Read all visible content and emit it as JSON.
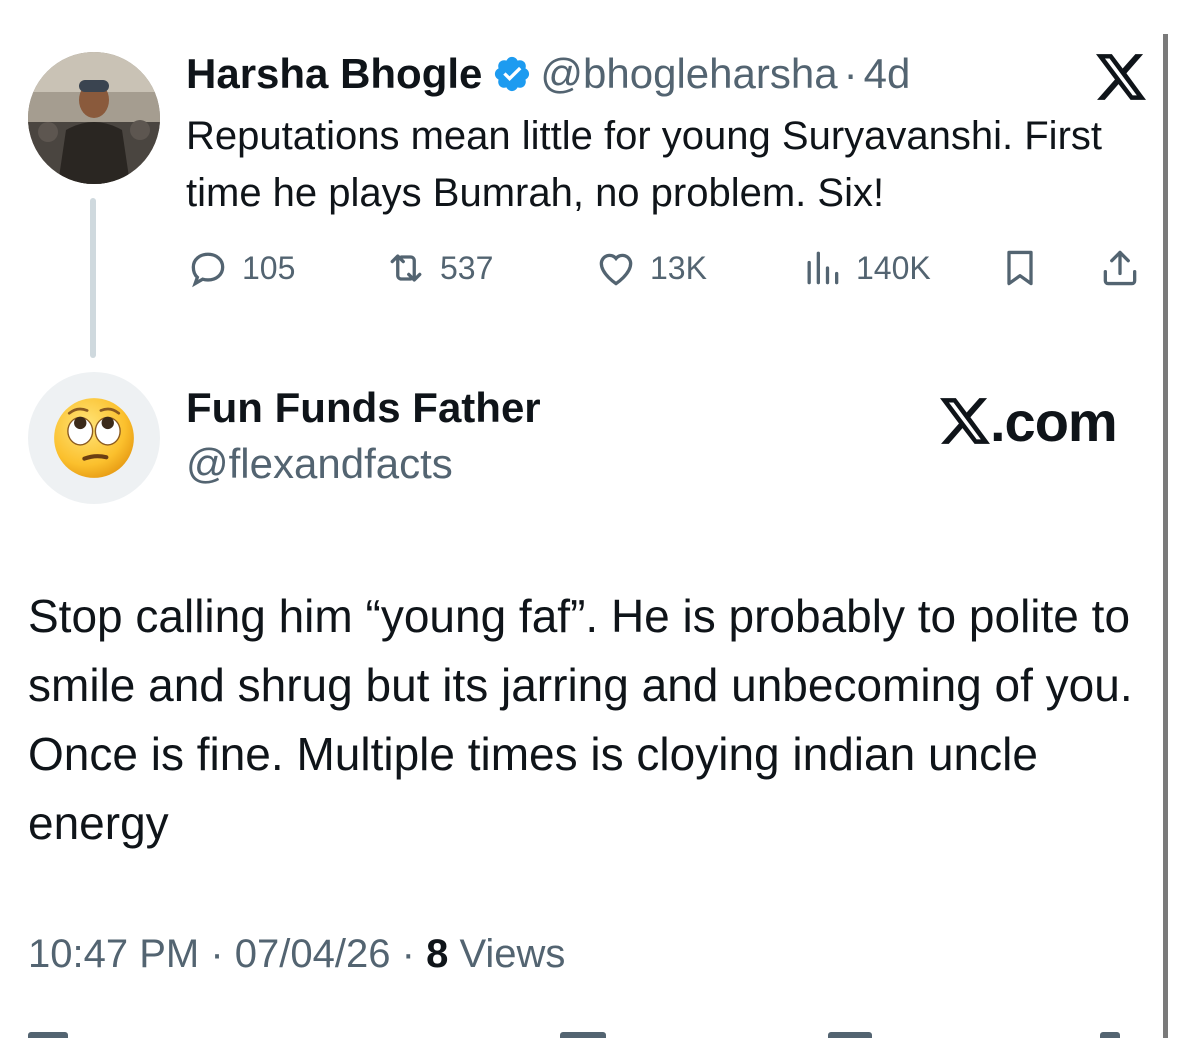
{
  "parent_tweet": {
    "name": "Harsha Bhogle",
    "handle": "@bhogleharsha",
    "separator": "·",
    "time": "4d",
    "text": "Reputations mean little for young Suryavanshi. First time he plays Bumrah, no problem. Six!",
    "actions": {
      "replies": "105",
      "reposts": "537",
      "likes": "13K",
      "views": "140K"
    },
    "verified_color": "#1d9bf0"
  },
  "reply": {
    "name": "Fun Funds Father",
    "handle": "@flexandfacts",
    "brand": ".com",
    "text": "Stop calling him “young faf”. He is probably to polite to smile and shrug but its jarring and unbecoming of you. Once is fine. Multiple times is cloying indian uncle energy",
    "time": "10:47 PM",
    "date": "07/04/26",
    "separator": "·",
    "views_count": "8",
    "views_label": "Views"
  },
  "colors": {
    "text": "#0f1419",
    "secondary": "#536471",
    "thread_line": "#cfd9de"
  }
}
